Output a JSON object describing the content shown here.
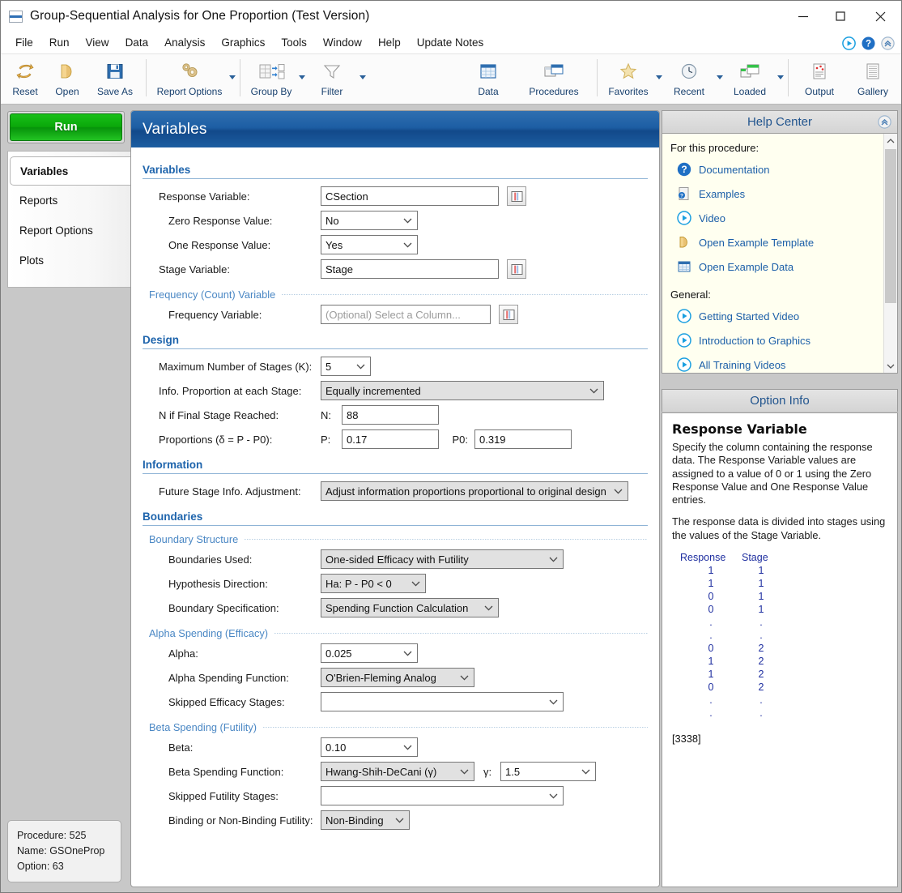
{
  "window": {
    "title": "Group-Sequential Analysis for One Proportion (Test Version)",
    "icon": "window-icon",
    "minimize": "minimize-icon",
    "maximize": "maximize-icon",
    "close": "close-icon"
  },
  "menubar": {
    "items": [
      {
        "label": "File"
      },
      {
        "label": "Run"
      },
      {
        "label": "View"
      },
      {
        "label": "Data"
      },
      {
        "label": "Analysis"
      },
      {
        "label": "Graphics"
      },
      {
        "label": "Tools"
      },
      {
        "label": "Window"
      },
      {
        "label": "Help"
      },
      {
        "label": "Update Notes"
      }
    ],
    "right_icons": [
      "play-circle-icon",
      "help-question-icon",
      "collapse-chevrons-icon"
    ]
  },
  "toolbar": {
    "left": [
      {
        "label": "Reset",
        "icon": "reset-arrows-icon",
        "caret": false
      },
      {
        "label": "Open",
        "icon": "open-folder-icon",
        "caret": false
      },
      {
        "label": "Save As",
        "icon": "floppy-disk-icon",
        "caret": false
      },
      {
        "label": "Report Options",
        "icon": "gears-icon",
        "caret": true
      },
      {
        "label": "Group By",
        "icon": "group-by-icon",
        "caret": true
      },
      {
        "label": "Filter",
        "icon": "funnel-filter-icon",
        "caret": true
      }
    ],
    "right": [
      {
        "label": "Data",
        "icon": "data-grid-icon",
        "caret": false
      },
      {
        "label": "Procedures",
        "icon": "procedures-windows-icon",
        "caret": false
      },
      {
        "label": "Favorites",
        "icon": "star-icon",
        "caret": true
      },
      {
        "label": "Recent",
        "icon": "clock-icon",
        "caret": true
      },
      {
        "label": "Loaded",
        "icon": "loaded-windows-icon",
        "caret": true
      },
      {
        "label": "Output",
        "icon": "output-report-icon",
        "caret": false
      },
      {
        "label": "Gallery",
        "icon": "gallery-lines-icon",
        "caret": false
      }
    ]
  },
  "sidebar": {
    "run_label": "Run",
    "nav": [
      {
        "label": "Variables",
        "active": true
      },
      {
        "label": "Reports",
        "active": false
      },
      {
        "label": "Report Options",
        "active": false
      },
      {
        "label": "Plots",
        "active": false
      }
    ],
    "procedure_info": {
      "procedure": "Procedure: 525",
      "name": "Name: GSOneProp",
      "option": "Option: 63"
    }
  },
  "main": {
    "header_title": "Variables",
    "sections": {
      "variables": {
        "title": "Variables",
        "response_variable": {
          "label": "Response Variable:",
          "value": "CSection",
          "picker": "column-picker-icon"
        },
        "zero_response_value": {
          "label": "Zero Response Value:",
          "value": "No"
        },
        "one_response_value": {
          "label": "One Response Value:",
          "value": "Yes"
        },
        "stage_variable": {
          "label": "Stage Variable:",
          "value": "Stage",
          "picker": "column-picker-icon"
        }
      },
      "frequency": {
        "title": "Frequency (Count) Variable",
        "frequency_variable": {
          "label": "Frequency Variable:",
          "value": "",
          "placeholder": "(Optional) Select a Column...",
          "picker": "column-picker-icon"
        }
      },
      "design": {
        "title": "Design",
        "max_stages": {
          "label": "Maximum Number of Stages (K):",
          "value": "5"
        },
        "info_proportion": {
          "label": "Info. Proportion at each Stage:",
          "value": "Equally incremented"
        },
        "n_final_stage": {
          "label": "N if Final Stage Reached:",
          "prefix": "N:",
          "value": "88"
        },
        "proportions": {
          "label": "Proportions (δ = P - P0):",
          "p_prefix": "P:",
          "p_value": "0.17",
          "p0_prefix": "P0:",
          "p0_value": "0.319"
        }
      },
      "information": {
        "title": "Information",
        "future_stage": {
          "label": "Future Stage Info. Adjustment:",
          "value": "Adjust information proportions proportional to original design"
        }
      },
      "boundaries": {
        "title": "Boundaries",
        "boundary_structure": {
          "title": "Boundary Structure",
          "boundaries_used": {
            "label": "Boundaries Used:",
            "value": "One-sided Efficacy with Futility"
          },
          "hypothesis_direction": {
            "label": "Hypothesis Direction:",
            "value": "Ha: P - P0 < 0"
          },
          "boundary_specification": {
            "label": "Boundary Specification:",
            "value": "Spending Function Calculation"
          }
        },
        "alpha_spending": {
          "title": "Alpha Spending (Efficacy)",
          "alpha": {
            "label": "Alpha:",
            "value": "0.025"
          },
          "alpha_function": {
            "label": "Alpha Spending Function:",
            "value": "O'Brien-Fleming Analog"
          },
          "skipped_efficacy": {
            "label": "Skipped Efficacy Stages:",
            "value": ""
          }
        },
        "beta_spending": {
          "title": "Beta Spending (Futility)",
          "beta": {
            "label": "Beta:",
            "value": "0.10"
          },
          "beta_function": {
            "label": "Beta Spending Function:",
            "value": "Hwang-Shih-DeCani (γ)"
          },
          "gamma": {
            "label": "γ:",
            "value": "1.5"
          },
          "skipped_futility": {
            "label": "Skipped Futility Stages:",
            "value": ""
          },
          "binding": {
            "label": "Binding or Non-Binding Futility:",
            "value": "Non-Binding"
          }
        }
      }
    }
  },
  "help_center": {
    "title": "Help Center",
    "collapse_icon": "collapse-chevrons-icon",
    "group_procedure": "For this procedure:",
    "procedure_links": [
      {
        "label": "Documentation",
        "icon": "help-question-icon"
      },
      {
        "label": "Examples",
        "icon": "examples-doc-icon"
      },
      {
        "label": "Video",
        "icon": "play-circle-icon"
      },
      {
        "label": "Open Example Template",
        "icon": "template-folder-icon"
      },
      {
        "label": "Open Example Data",
        "icon": "data-grid-icon"
      }
    ],
    "group_general": "General:",
    "general_links": [
      {
        "label": "Getting Started Video",
        "icon": "play-circle-icon"
      },
      {
        "label": "Introduction to Graphics",
        "icon": "play-circle-icon"
      },
      {
        "label": "All Training Videos",
        "icon": "play-circle-icon"
      }
    ],
    "scroll_up": "scroll-up-icon",
    "scroll_down": "scroll-down-icon"
  },
  "option_info": {
    "title": "Option Info",
    "heading": "Response Variable",
    "paragraph1": "Specify the column containing the response data. The Response Variable values are assigned to a value of 0 or 1 using the Zero Response Value and One Response Value entries.",
    "paragraph2": "The response data is divided into stages using the values of the Stage Variable.",
    "table": {
      "headers": [
        "Response",
        "Stage"
      ],
      "rows": [
        [
          "1",
          "1"
        ],
        [
          "1",
          "1"
        ],
        [
          "0",
          "1"
        ],
        [
          "0",
          "1"
        ],
        [
          ".",
          "."
        ],
        [
          ".",
          "."
        ],
        [
          "0",
          "2"
        ],
        [
          "1",
          "2"
        ],
        [
          "1",
          "2"
        ],
        [
          "0",
          "2"
        ],
        [
          ".",
          "."
        ],
        [
          ".",
          "."
        ]
      ]
    },
    "code": "[3338]"
  },
  "colors": {
    "accent_blue": "#1e64ac",
    "header_blue": "#1d5ea4",
    "run_green": "#0aa80a",
    "link_blue": "#1c5fa8",
    "help_bg": "#fffff0"
  }
}
